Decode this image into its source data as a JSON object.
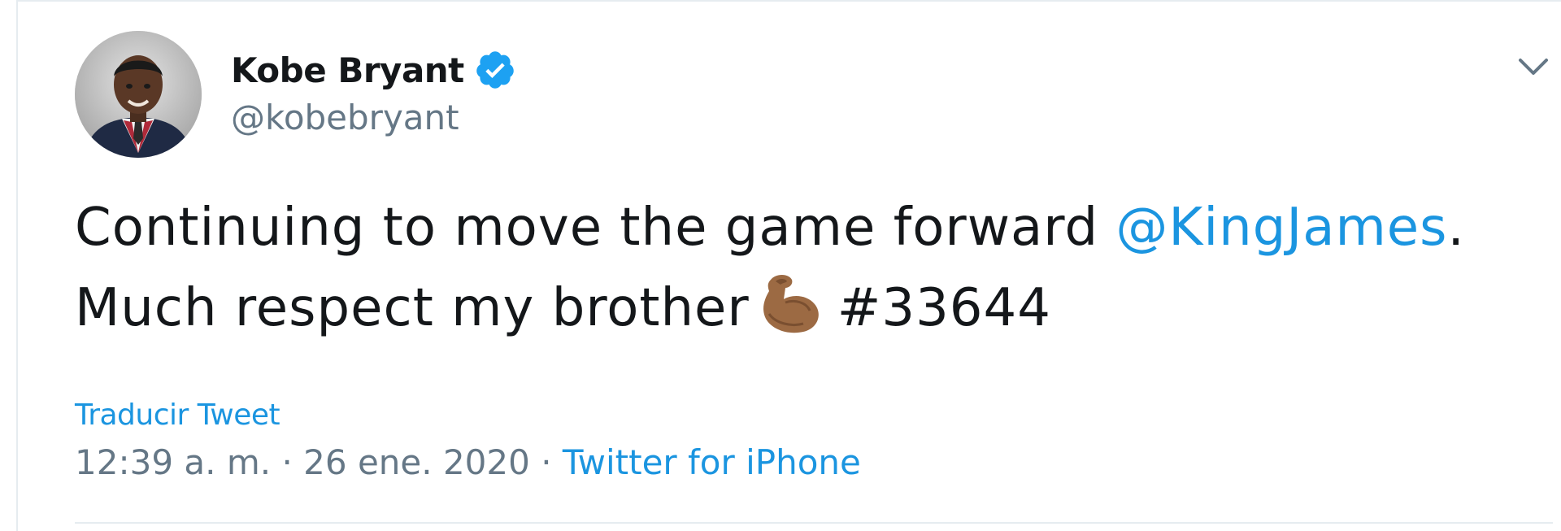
{
  "author": {
    "name": "Kobe Bryant",
    "handle": "@kobebryant",
    "verified": true
  },
  "tweet": {
    "text_part1": "Continuing to move the game forward ",
    "mention": "@KingJames",
    "text_part2": ".",
    "text_line2": "Much respect my brother",
    "hashtag": "#33644",
    "emoji": "flexed-biceps-icon"
  },
  "actions": {
    "translate_label": "Traducir Tweet"
  },
  "meta": {
    "time": "12:39 a. m.",
    "separator": " · ",
    "date": "26 ene. 2020",
    "source": "Twitter for iPhone"
  },
  "colors": {
    "link": "#1b95e0",
    "text": "#14171a",
    "secondary": "#657786",
    "border": "#e6ecf0",
    "verified": "#1da1f2"
  }
}
